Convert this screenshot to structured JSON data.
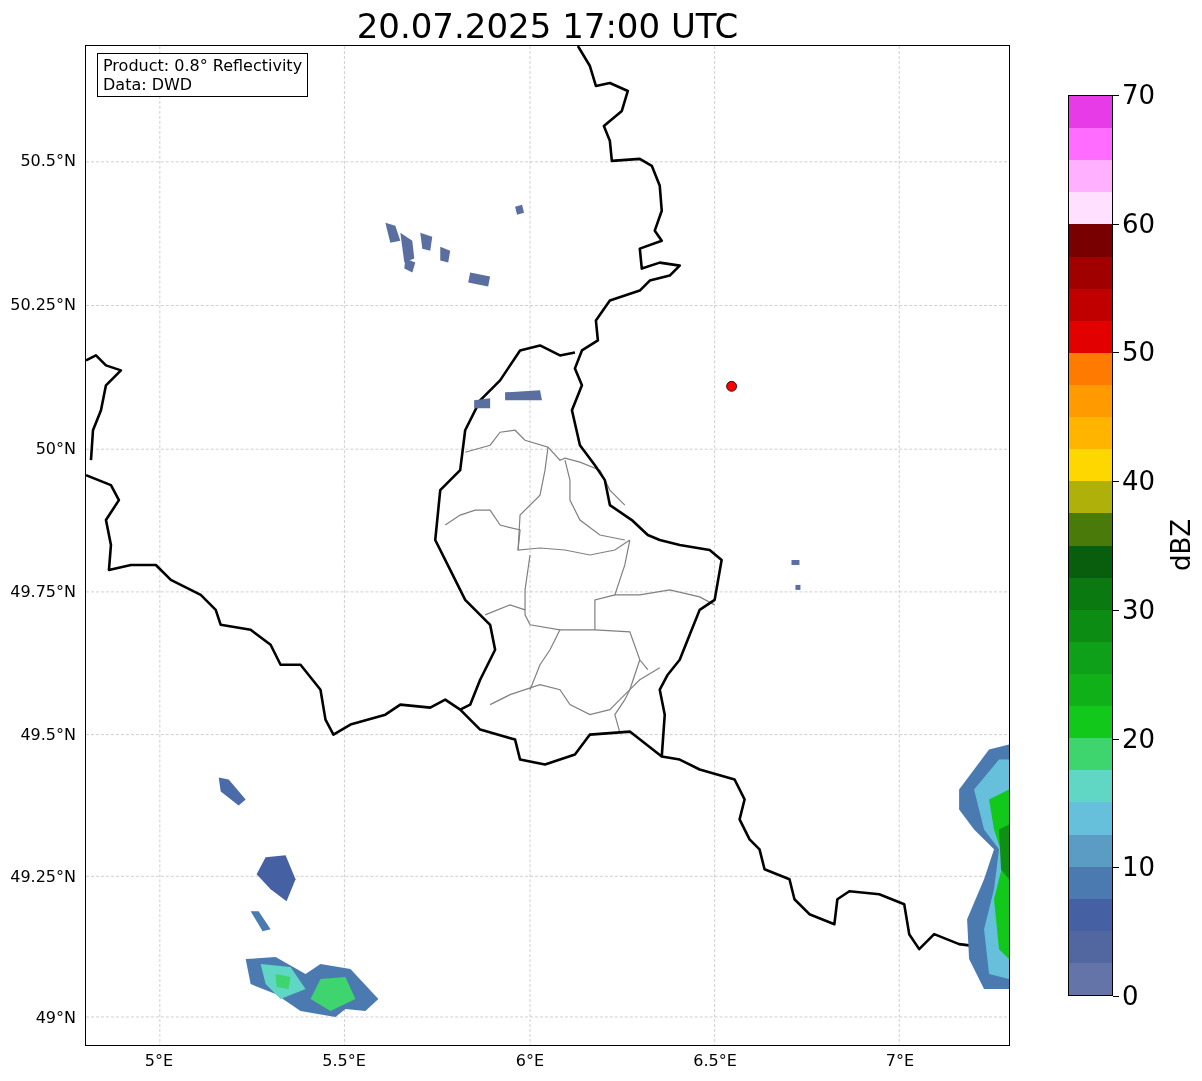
{
  "title": "20.07.2025 17:00 UTC",
  "info_box": [
    "Product: 0.8° Reflectivity",
    "Data: DWD"
  ],
  "map": {
    "lat_labels": [
      "50.5°N",
      "50.25°N",
      "50°N",
      "49.75°N",
      "49.5°N",
      "49.25°N",
      "49°N"
    ],
    "lon_labels": [
      "5°E",
      "5.5°E",
      "6°E",
      "6.5°E",
      "7°E"
    ]
  },
  "colorbar": {
    "label": "dBZ",
    "ticks": [
      "70",
      "60",
      "50",
      "40",
      "30",
      "20",
      "10",
      "0"
    ],
    "segments": [
      {
        "color": "#e83be8"
      },
      {
        "color": "#ff6cff"
      },
      {
        "color": "#ffb0ff"
      },
      {
        "color": "#ffe0ff"
      },
      {
        "color": "#780000"
      },
      {
        "color": "#a00000"
      },
      {
        "color": "#c00000"
      },
      {
        "color": "#e20000"
      },
      {
        "color": "#ff7a00"
      },
      {
        "color": "#ff9a00"
      },
      {
        "color": "#ffb400"
      },
      {
        "color": "#ffd700"
      },
      {
        "color": "#b0b00a"
      },
      {
        "color": "#4a7a0a"
      },
      {
        "color": "#085e0c"
      },
      {
        "color": "#0a7a10"
      },
      {
        "color": "#0c8c12"
      },
      {
        "color": "#0ea018"
      },
      {
        "color": "#10b018"
      },
      {
        "color": "#12c81a"
      },
      {
        "color": "#3ed46e"
      },
      {
        "color": "#60d6c4"
      },
      {
        "color": "#66c0dc"
      },
      {
        "color": "#5a9cc4"
      },
      {
        "color": "#4a7ab0"
      },
      {
        "color": "#4560a3"
      },
      {
        "color": "#52679f"
      },
      {
        "color": "#6474a8"
      }
    ]
  }
}
